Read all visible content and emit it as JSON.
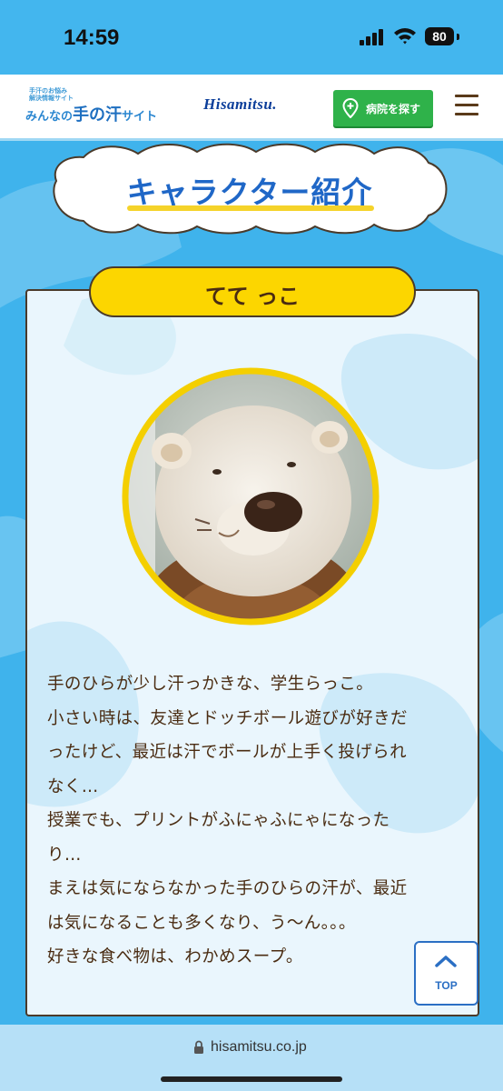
{
  "status_bar": {
    "time": "14:59",
    "battery": "80"
  },
  "header": {
    "logo_small": [
      "手汗のお悩み",
      "解決情報サイト"
    ],
    "logo_main_pre": "みんなの",
    "logo_main_big": "手の汗",
    "logo_main_post": "サイト",
    "brand": "Hisamitsu.",
    "find_hospital_button": "病院を探す"
  },
  "page": {
    "title": "キャラクター紹介",
    "character_name": "てて っこ",
    "description_lines": [
      "手のひらが少し汗っかきな、学生らっこ。",
      "小さい時は、友達とドッチボール遊びが好きだ",
      "ったけど、最近は汗でボールが上手く投げられ",
      "なく…",
      "授業でも、プリントがふにゃふにゃになった",
      "り…",
      "まえは気にならなかった手のひらの汗が、最近",
      "は気になることも多くなり、う〜ん。。。",
      "好きな食べ物は、わかめスープ。"
    ],
    "top_button": "TOP"
  },
  "url_bar": {
    "url": "hisamitsu.co.jp"
  },
  "colors": {
    "sky": "#3fb3ec",
    "title_blue": "#1f67c7",
    "yellow": "#fcd600",
    "green": "#2fb24a",
    "brown_text": "#4a2c12"
  }
}
